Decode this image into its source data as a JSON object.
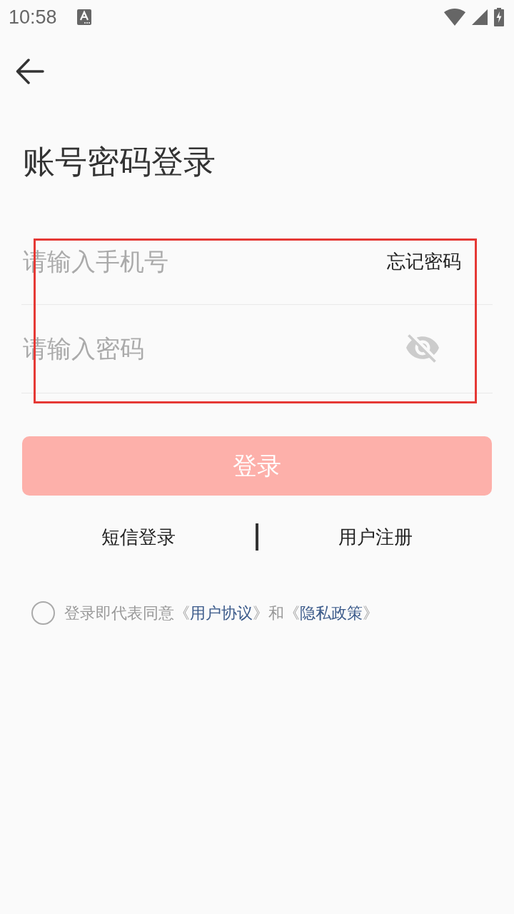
{
  "status_bar": {
    "time": "10:58"
  },
  "title": "账号密码登录",
  "form": {
    "phone_field": {
      "placeholder": "请输入手机号"
    },
    "forgot_password": "忘记密码",
    "password_field": {
      "placeholder": "请输入密码",
      "password_visible": false
    }
  },
  "annotation": {
    "kind": "frame"
  },
  "login_button": {
    "label": "登录",
    "disabled": true
  },
  "links": [
    "短信登录",
    "用户注册"
  ],
  "agreement": {
    "checked": false,
    "parts": [
      {
        "kind": "text",
        "text": "登录即代表同意《"
      },
      {
        "kind": "link",
        "text": "用户协议"
      },
      {
        "kind": "text",
        "text": "》和《"
      },
      {
        "kind": "link",
        "text": "隐私政策"
      },
      {
        "kind": "text",
        "text": "》"
      }
    ]
  }
}
